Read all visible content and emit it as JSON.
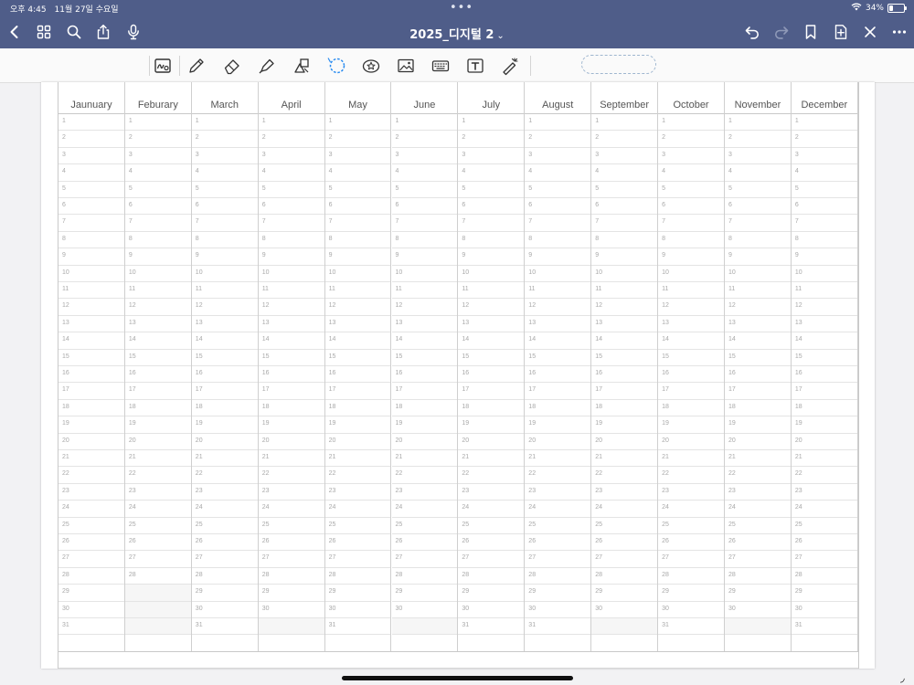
{
  "status_bar": {
    "time": "오후 4:45",
    "date": "11월 27일 수요일",
    "battery_percent": "34%",
    "battery_level": 0.34
  },
  "header": {
    "document_title": "2025_디지털 2",
    "title_chevron": "⌄"
  },
  "colors": {
    "header_bg": "#4f5d89",
    "toolbar_bg": "#fafafa",
    "accent_blue": "#2a8cf0"
  },
  "toolbar": {
    "tools": [
      "handwriting-mode-icon",
      "pen-icon",
      "eraser-icon",
      "highlighter-icon",
      "shapes-icon",
      "lasso-icon",
      "sticker-icon",
      "image-icon",
      "keyboard-icon",
      "text-box-icon",
      "laser-pointer-icon"
    ]
  },
  "months": [
    "Jaunuary",
    "Feburary",
    "March",
    "April",
    "May",
    "June",
    "July",
    "August",
    "September",
    "October",
    "November",
    "December"
  ],
  "days_in_month": [
    31,
    28,
    31,
    30,
    31,
    30,
    31,
    31,
    30,
    31,
    30,
    31
  ],
  "grid_rows": 31
}
